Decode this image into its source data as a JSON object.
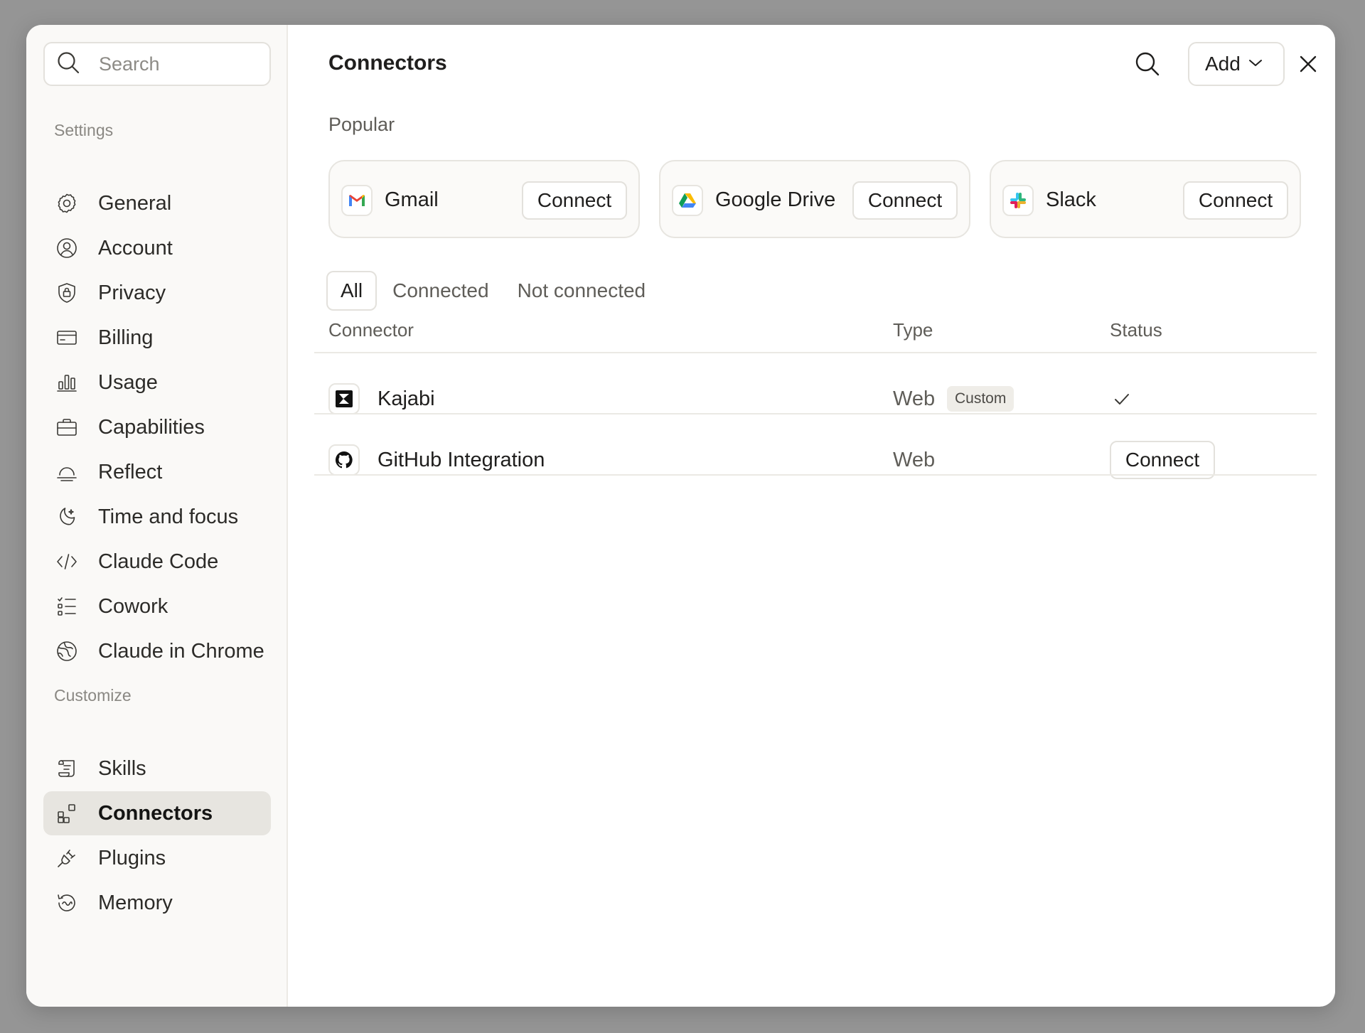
{
  "sidebar": {
    "search_placeholder": "Search",
    "settings_label": "Settings",
    "settings_items": [
      {
        "label": "General",
        "icon": "gear-icon"
      },
      {
        "label": "Account",
        "icon": "user-circle-icon"
      },
      {
        "label": "Privacy",
        "icon": "shield-lock-icon"
      },
      {
        "label": "Billing",
        "icon": "credit-card-icon"
      },
      {
        "label": "Usage",
        "icon": "bar-chart-icon"
      },
      {
        "label": "Capabilities",
        "icon": "briefcase-icon"
      },
      {
        "label": "Reflect",
        "icon": "sunrise-icon"
      },
      {
        "label": "Time and focus",
        "icon": "moon-icon"
      },
      {
        "label": "Claude Code",
        "icon": "code-icon"
      },
      {
        "label": "Cowork",
        "icon": "checklist-icon"
      },
      {
        "label": "Claude in Chrome",
        "icon": "globe-icon"
      }
    ],
    "customize_label": "Customize",
    "customize_items": [
      {
        "label": "Skills",
        "icon": "scroll-icon"
      },
      {
        "label": "Connectors",
        "icon": "connectors-icon",
        "active": true
      },
      {
        "label": "Plugins",
        "icon": "plug-icon"
      },
      {
        "label": "Memory",
        "icon": "memory-icon"
      }
    ]
  },
  "header": {
    "title": "Connectors",
    "add_label": "Add"
  },
  "popular": {
    "label": "Popular",
    "cards": [
      {
        "name": "Gmail",
        "button": "Connect",
        "icon": "gmail-icon"
      },
      {
        "name": "Google Drive",
        "button": "Connect",
        "icon": "google-drive-icon"
      },
      {
        "name": "Slack",
        "button": "Connect",
        "icon": "slack-icon"
      }
    ]
  },
  "tabs": [
    "All",
    "Connected",
    "Not connected"
  ],
  "active_tab": "All",
  "table": {
    "columns": [
      "Connector",
      "Type",
      "Status"
    ],
    "rows": [
      {
        "name": "Kajabi",
        "type": "Web",
        "badge": "Custom",
        "status": "connected",
        "icon": "kajabi-icon"
      },
      {
        "name": "GitHub Integration",
        "type": "Web",
        "status_button": "Connect",
        "icon": "github-icon"
      }
    ]
  },
  "colors": {
    "backdrop": "#959595",
    "active_nav_bg": "#e7e5e0",
    "sidebar_bg": "#faf9f7"
  }
}
